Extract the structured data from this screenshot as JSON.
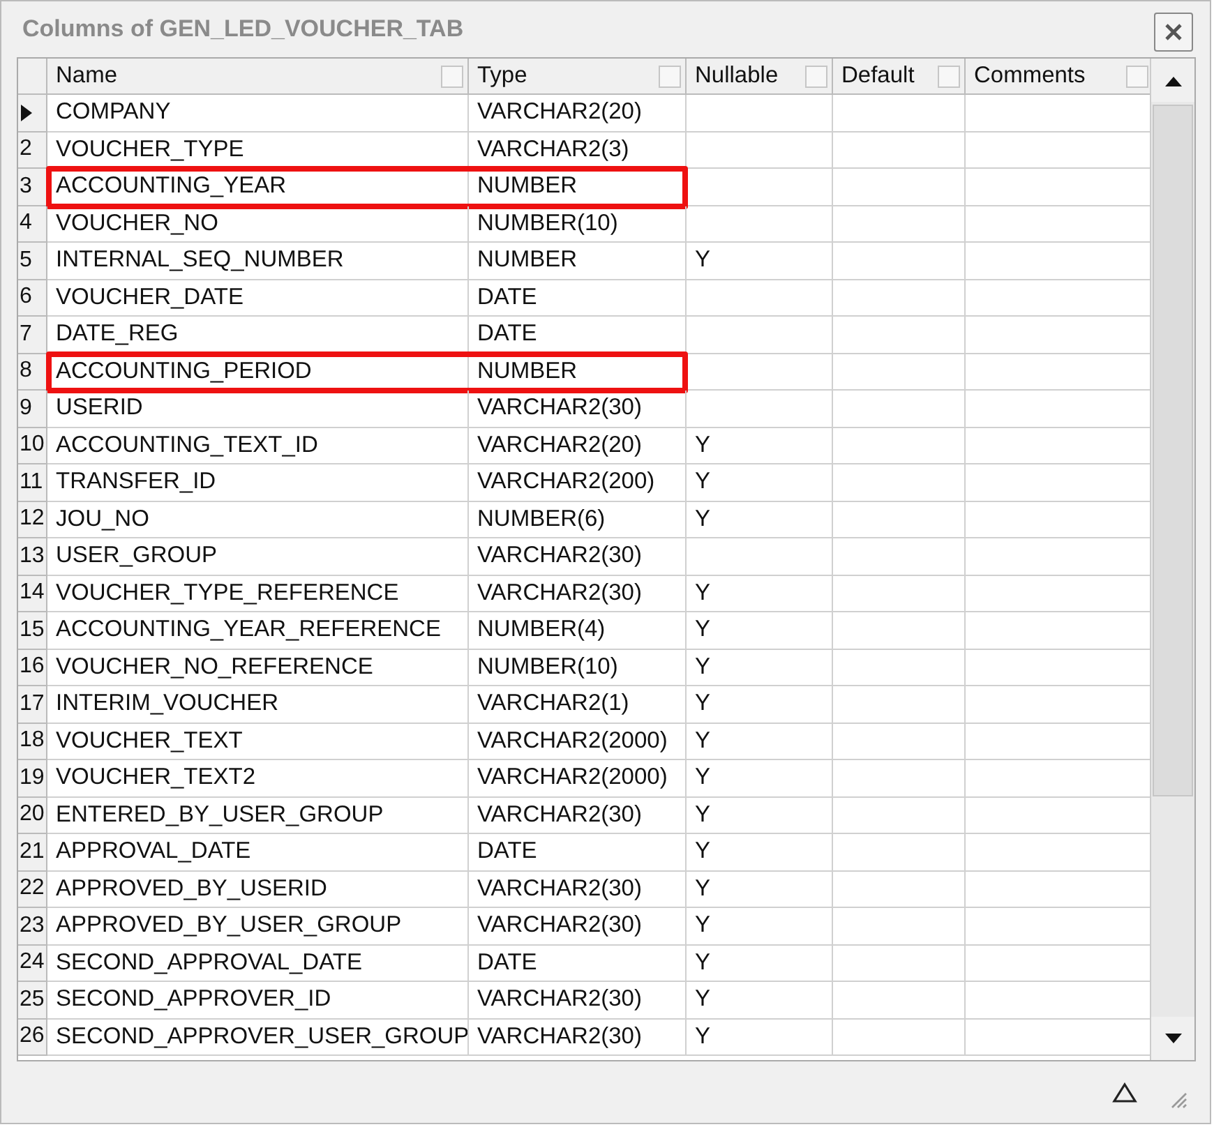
{
  "window": {
    "title": "Columns of GEN_LED_VOUCHER_TAB"
  },
  "table": {
    "columns": [
      "Name",
      "Type",
      "Nullable",
      "Default",
      "Comments"
    ],
    "rows": [
      {
        "current": true,
        "name": "COMPANY",
        "type": "VARCHAR2(20)",
        "highlighted": false
      },
      {
        "current": false,
        "number": "2",
        "name": "VOUCHER_TYPE",
        "type": "VARCHAR2(3)",
        "highlighted": false
      },
      {
        "current": false,
        "number": "3",
        "name": "ACCOUNTING_YEAR",
        "type": "NUMBER",
        "highlighted": true
      },
      {
        "current": false,
        "number": "4",
        "name": "VOUCHER_NO",
        "type": "NUMBER(10)",
        "highlighted": false
      },
      {
        "current": false,
        "number": "5",
        "name": "INTERNAL_SEQ_NUMBER",
        "type": "NUMBER",
        "nullable": "Y",
        "highlighted": false
      },
      {
        "current": false,
        "number": "6",
        "name": "VOUCHER_DATE",
        "type": "DATE",
        "highlighted": false
      },
      {
        "current": false,
        "number": "7",
        "name": "DATE_REG",
        "type": "DATE",
        "highlighted": false
      },
      {
        "current": false,
        "number": "8",
        "name": "ACCOUNTING_PERIOD",
        "type": "NUMBER",
        "highlighted": true
      },
      {
        "current": false,
        "number": "9",
        "name": "USERID",
        "type": "VARCHAR2(30)",
        "highlighted": false
      },
      {
        "current": false,
        "number": "10",
        "name": "ACCOUNTING_TEXT_ID",
        "type": "VARCHAR2(20)",
        "nullable": "Y",
        "highlighted": false
      },
      {
        "current": false,
        "number": "11",
        "name": "TRANSFER_ID",
        "type": "VARCHAR2(200)",
        "nullable": "Y",
        "highlighted": false
      },
      {
        "current": false,
        "number": "12",
        "name": "JOU_NO",
        "type": "NUMBER(6)",
        "nullable": "Y",
        "highlighted": false
      },
      {
        "current": false,
        "number": "13",
        "name": "USER_GROUP",
        "type": "VARCHAR2(30)",
        "highlighted": false
      },
      {
        "current": false,
        "number": "14",
        "name": "VOUCHER_TYPE_REFERENCE",
        "type": "VARCHAR2(30)",
        "nullable": "Y",
        "highlighted": false
      },
      {
        "current": false,
        "number": "15",
        "name": "ACCOUNTING_YEAR_REFERENCE",
        "type": "NUMBER(4)",
        "nullable": "Y",
        "highlighted": false
      },
      {
        "current": false,
        "number": "16",
        "name": "VOUCHER_NO_REFERENCE",
        "type": "NUMBER(10)",
        "nullable": "Y",
        "highlighted": false
      },
      {
        "current": false,
        "number": "17",
        "name": "INTERIM_VOUCHER",
        "type": "VARCHAR2(1)",
        "nullable": "Y",
        "highlighted": false
      },
      {
        "current": false,
        "number": "18",
        "name": "VOUCHER_TEXT",
        "type": "VARCHAR2(2000)",
        "nullable": "Y",
        "highlighted": false
      },
      {
        "current": false,
        "number": "19",
        "name": "VOUCHER_TEXT2",
        "type": "VARCHAR2(2000)",
        "nullable": "Y",
        "highlighted": false
      },
      {
        "current": false,
        "number": "20",
        "name": "ENTERED_BY_USER_GROUP",
        "type": "VARCHAR2(30)",
        "nullable": "Y",
        "highlighted": false
      },
      {
        "current": false,
        "number": "21",
        "name": "APPROVAL_DATE",
        "type": "DATE",
        "nullable": "Y",
        "highlighted": false
      },
      {
        "current": false,
        "number": "22",
        "name": "APPROVED_BY_USERID",
        "type": "VARCHAR2(30)",
        "nullable": "Y",
        "highlighted": false
      },
      {
        "current": false,
        "number": "23",
        "name": "APPROVED_BY_USER_GROUP",
        "type": "VARCHAR2(30)",
        "nullable": "Y",
        "highlighted": false
      },
      {
        "current": false,
        "number": "24",
        "name": "SECOND_APPROVAL_DATE",
        "type": "DATE",
        "nullable": "Y",
        "highlighted": false
      },
      {
        "current": false,
        "number": "25",
        "name": "SECOND_APPROVER_ID",
        "type": "VARCHAR2(30)",
        "nullable": "Y",
        "highlighted": false
      },
      {
        "current": false,
        "number": "26",
        "name": "SECOND_APPROVER_USER_GROUP",
        "type": "VARCHAR2(30)",
        "nullable": "Y",
        "highlighted": false
      }
    ]
  }
}
